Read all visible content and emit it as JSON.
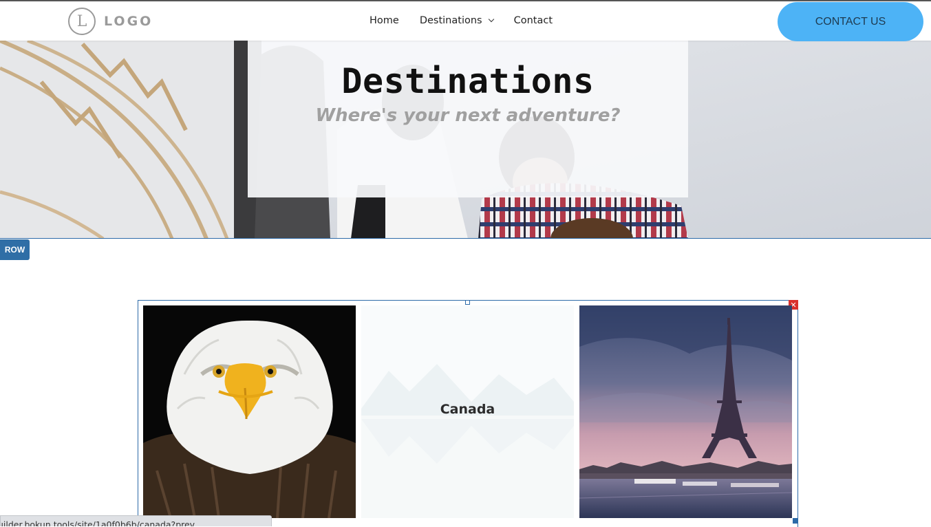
{
  "header": {
    "logo_letter": "L",
    "logo_text": "LOGO",
    "nav": [
      {
        "label": "Home"
      },
      {
        "label": "Destinations",
        "has_dropdown": true
      },
      {
        "label": "Contact"
      }
    ],
    "cta_label": "CONTACT US",
    "cta_color": "#4db3f6"
  },
  "hero": {
    "title": "Destinations",
    "subtitle": "Where's your next adventure?"
  },
  "editor": {
    "row_badge": "ROW",
    "close_symbol": "✕",
    "accent_color": "#2f6ea6"
  },
  "gallery": {
    "tiles": [
      {
        "image": "bald-eagle-photo",
        "label": ""
      },
      {
        "image": "mountain-lake-photo",
        "label": "Canada"
      },
      {
        "image": "eiffel-tower-photo",
        "label": ""
      }
    ]
  },
  "status_bar": {
    "url": "uilder.bokun.tools/site/1a0f0b6b/canada?prev..."
  }
}
